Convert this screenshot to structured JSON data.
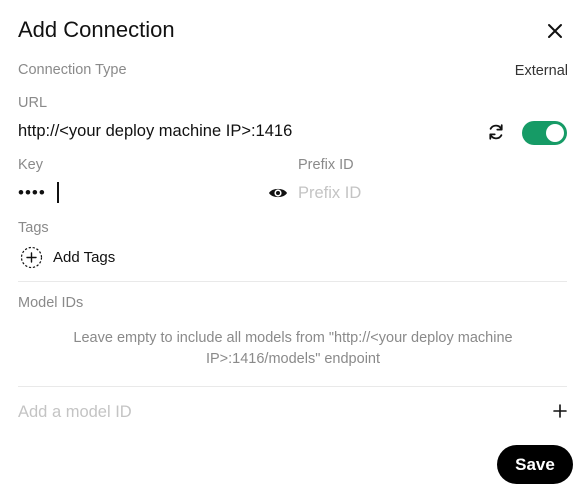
{
  "dialog": {
    "title": "Add Connection"
  },
  "connection_type": {
    "label": "Connection Type",
    "value": "External"
  },
  "url": {
    "label": "URL",
    "value": "http://<your deploy machine IP>:1416",
    "enabled": true
  },
  "key": {
    "label": "Key",
    "masked_value": "••••"
  },
  "prefix_id": {
    "label": "Prefix ID",
    "placeholder": "Prefix ID"
  },
  "tags": {
    "label": "Tags",
    "add_label": "Add Tags"
  },
  "model_ids": {
    "label": "Model IDs",
    "hint": "Leave empty to include all models from \"http://<your deploy machine IP>:1416/models\" endpoint",
    "input_placeholder": "Add a model ID"
  },
  "actions": {
    "save_label": "Save"
  },
  "colors": {
    "toggle_on": "#169b66",
    "save_bg": "#000000",
    "muted_text": "#8a8a8a",
    "placeholder_text": "#c4c4c4"
  },
  "icons": {
    "close": "close-icon",
    "refresh": "refresh-icon",
    "eye": "eye-icon",
    "add_tag": "plus-circle-icon",
    "add_model": "plus-icon"
  }
}
